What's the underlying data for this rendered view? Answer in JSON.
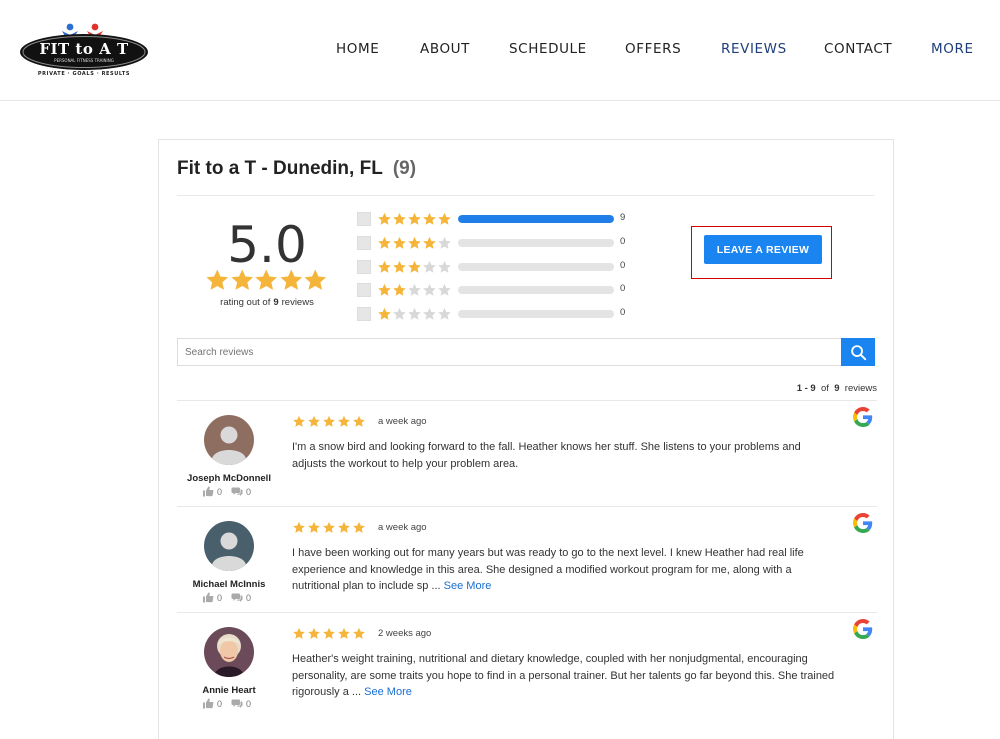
{
  "brand": {
    "logo_text": "FIT to A T",
    "logo_subtitle": "PERSONAL FITNESS TRAINING",
    "logo_tagline": "PRIVATE · GOALS · RESULTS"
  },
  "nav": {
    "items": [
      {
        "label": "HOME"
      },
      {
        "label": "ABOUT"
      },
      {
        "label": "SCHEDULE"
      },
      {
        "label": "OFFERS"
      },
      {
        "label": "REVIEWS",
        "active": true
      },
      {
        "label": "CONTACT"
      },
      {
        "label": "MORE"
      }
    ]
  },
  "widget": {
    "business_name": "Fit to a T - Dunedin, FL",
    "review_count_display": "(9)",
    "average_rating": "5.0",
    "rating_out_of_prefix": "rating out of",
    "rating_out_of_count": "9",
    "rating_out_of_suffix": "reviews",
    "distribution": [
      {
        "stars": 5,
        "count": "9",
        "fraction": 1.0
      },
      {
        "stars": 4,
        "count": "0",
        "fraction": 0
      },
      {
        "stars": 3,
        "count": "0",
        "fraction": 0
      },
      {
        "stars": 2,
        "count": "0",
        "fraction": 0
      },
      {
        "stars": 1,
        "count": "0",
        "fraction": 0
      }
    ],
    "leave_review_label": "LEAVE A REVIEW",
    "search_placeholder": "Search reviews",
    "paging": {
      "range": "1 - 9",
      "of": "of",
      "total": "9",
      "suffix": "reviews"
    }
  },
  "reviews": [
    {
      "name": "Joseph McDonnell",
      "time": "a week ago",
      "rating": 5,
      "text": "I'm a snow bird and looking forward to the fall. Heather knows her stuff. She listens to your problems and adjusts the workout to help your problem area.",
      "see_more": "",
      "likes": "0",
      "comments": "0"
    },
    {
      "name": "Michael McInnis",
      "time": "a week ago",
      "rating": 5,
      "text": "I have been working out for many years but was ready to go to the next level. I knew Heather had real life experience and knowledge in this area. She designed a modified workout program for me, along with a nutritional plan to include sp ...",
      "see_more": "See More",
      "likes": "0",
      "comments": "0"
    },
    {
      "name": "Annie Heart",
      "time": "2 weeks ago",
      "rating": 5,
      "text": "Heather's weight training, nutritional and dietary knowledge, coupled with her nonjudgmental, encouraging personality, are some traits you hope to find in a personal trainer. But her talents go far beyond this. She trained rigorously a ...",
      "see_more": "See More",
      "likes": "0",
      "comments": "0"
    }
  ],
  "colors": {
    "accent": "#1a84f0",
    "star": "#f5b53a",
    "star_empty": "#d8d8d8",
    "nav_active": "#1f3f7a",
    "highlight_box": "#d40000"
  },
  "icons": [
    "search-icon",
    "google-icon",
    "thumbs-up-icon",
    "comment-icon",
    "star-icon",
    "avatar-placeholder-icon"
  ]
}
